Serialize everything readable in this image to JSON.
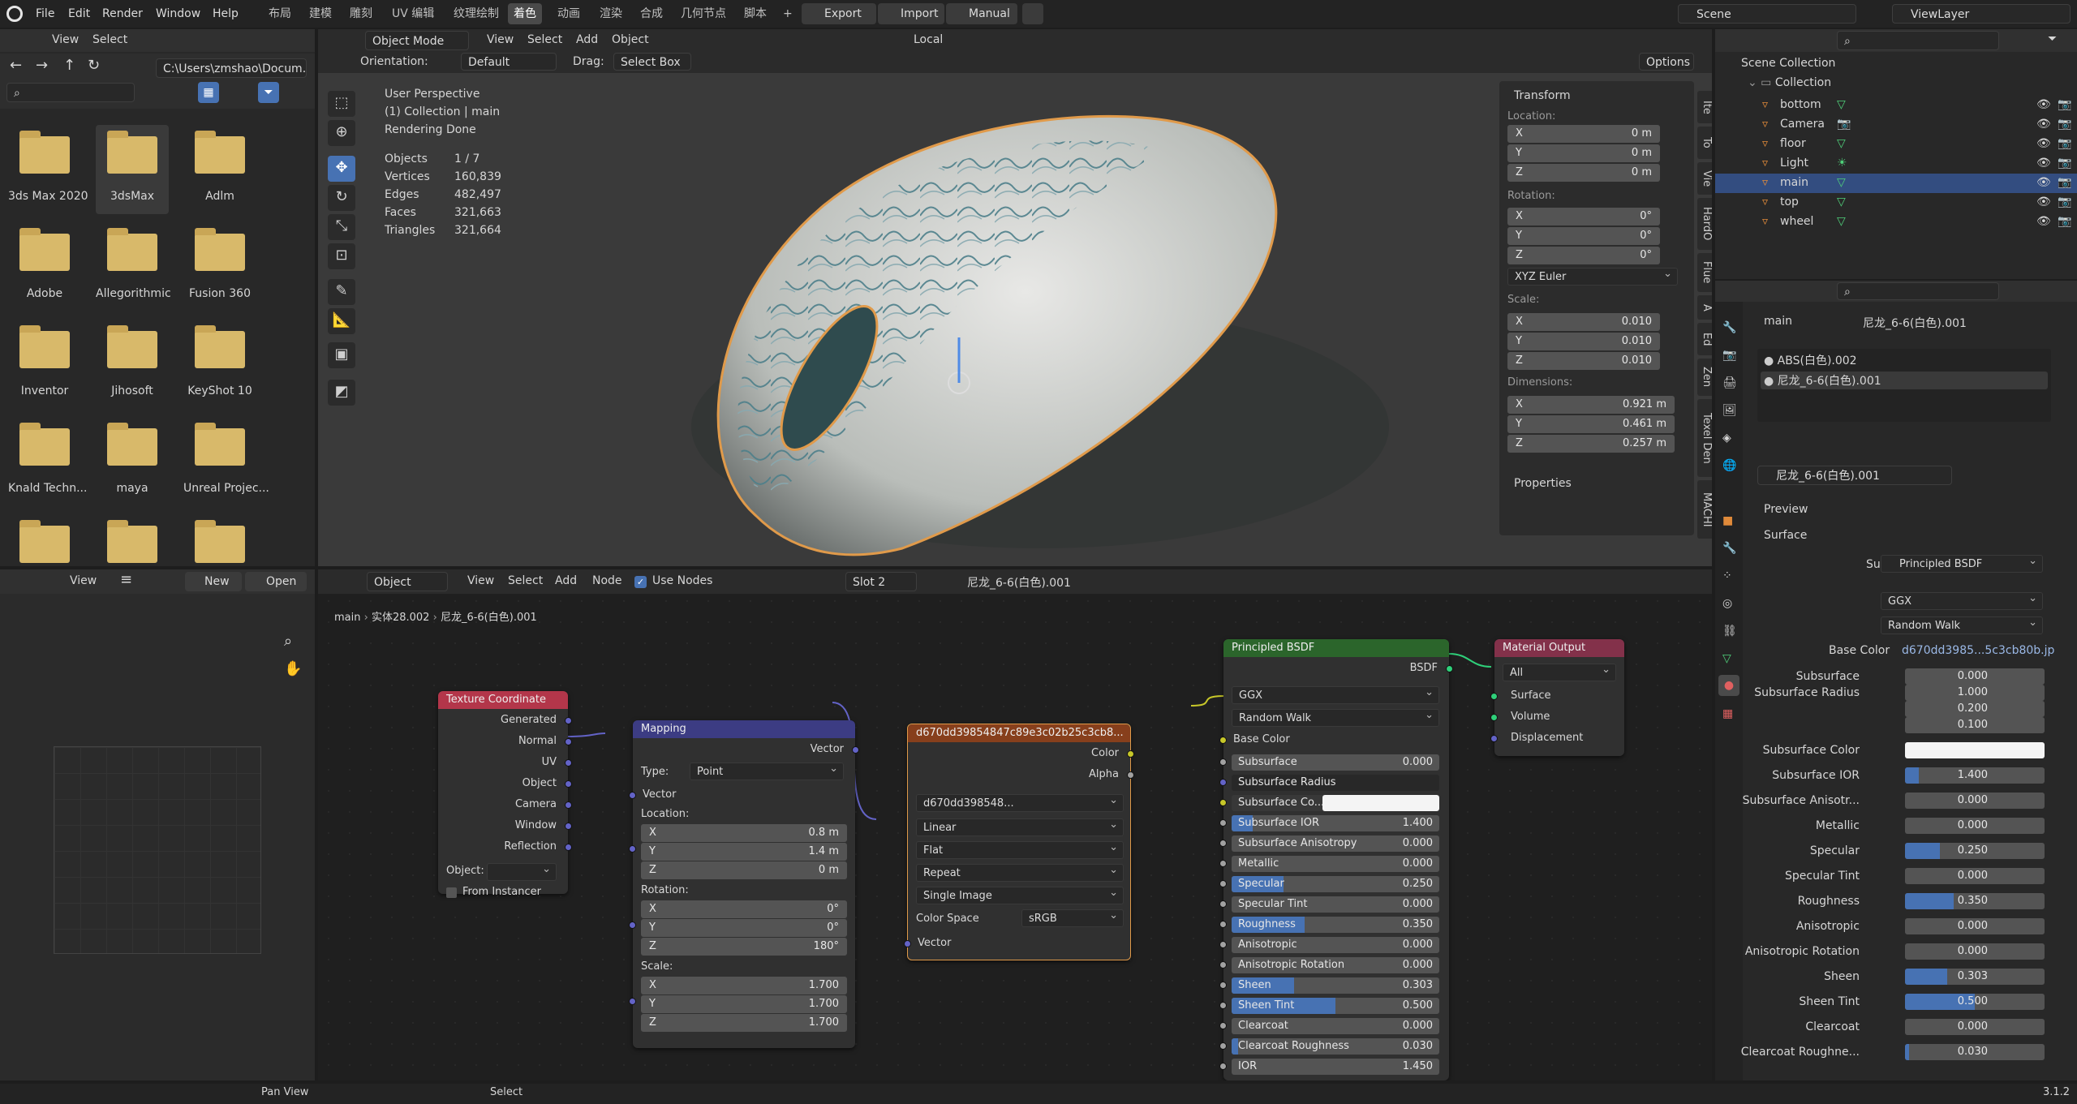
{
  "colors": {
    "accent": "#4772b3",
    "node_texcoord": "#b3364a",
    "node_mapping": "#3c3c83",
    "node_image": "#873f1c",
    "node_shader": "#2b652b",
    "node_output": "#83314a",
    "folder": "#d8b96a",
    "link_color": "#c7c729",
    "link_vector": "#6363c7"
  },
  "topbar": {
    "menus": [
      "File",
      "Edit",
      "Render",
      "Window",
      "Help"
    ],
    "workspaces": [
      "布局",
      "建模",
      "雕刻",
      "UV 编辑",
      "纹理绘制",
      "着色",
      "动画",
      "渲染",
      "合成",
      "几何节点",
      "脚本"
    ],
    "active_workspace": "着色",
    "export_label": "Export",
    "import_label": "Import",
    "manual_label": "Manual",
    "scene": "Scene",
    "view_layer": "ViewLayer"
  },
  "file_browser": {
    "view_label": "View",
    "select_label": "Select",
    "path": "C:\\Users\\zmshao\\Docum...",
    "folders": [
      "3ds Max 2020",
      "3dsMax",
      "Adlm",
      "Adobe",
      "Allegorithmic",
      "Fusion 360",
      "Inventor",
      "Jihosoft",
      "KeyShot 10",
      "Knald Techn...",
      "maya",
      "Unreal Projec..."
    ],
    "selected_folder": "3dsMax"
  },
  "viewport": {
    "mode": "Object Mode",
    "view": "View",
    "select": "Select",
    "add": "Add",
    "object": "Object",
    "orientation_label": "Orientation:",
    "orientation": "Default",
    "drag_label": "Drag:",
    "drag": "Select Box",
    "transform_space": "Local",
    "options": "Options",
    "overlay_title": "User Perspective",
    "overlay_collection": "(1) Collection | main",
    "overlay_status": "Rendering Done",
    "stats": [
      [
        "Objects",
        "1 / 7"
      ],
      [
        "Vertices",
        "160,839"
      ],
      [
        "Edges",
        "482,497"
      ],
      [
        "Faces",
        "321,663"
      ],
      [
        "Triangles",
        "321,664"
      ]
    ],
    "side_tabs": [
      "Ite",
      "To",
      "Vie",
      "HardO",
      "Flue",
      "A",
      "Ed",
      "Zen",
      "Texel Den",
      "MACHI"
    ]
  },
  "transform": {
    "title": "Transform",
    "location_label": "Location:",
    "location": [
      [
        "X",
        "0 m"
      ],
      [
        "Y",
        "0 m"
      ],
      [
        "Z",
        "0 m"
      ]
    ],
    "rotation_label": "Rotation:",
    "rotation": [
      [
        "X",
        "0°"
      ],
      [
        "Y",
        "0°"
      ],
      [
        "Z",
        "0°"
      ]
    ],
    "rotation_mode": "XYZ Euler",
    "scale_label": "Scale:",
    "scale": [
      [
        "X",
        "0.010"
      ],
      [
        "Y",
        "0.010"
      ],
      [
        "Z",
        "0.010"
      ]
    ],
    "dimensions_label": "Dimensions:",
    "dimensions": [
      [
        "X",
        "0.921 m"
      ],
      [
        "Y",
        "0.461 m"
      ],
      [
        "Z",
        "0.257 m"
      ]
    ],
    "properties": "Properties"
  },
  "image_editor": {
    "view": "View",
    "new": "New",
    "open": "Open"
  },
  "node_editor": {
    "object_mode": "Object",
    "view": "View",
    "select": "Select",
    "add": "Add",
    "node": "Node",
    "use_nodes": "Use Nodes",
    "slot": "Slot 2",
    "material": "尼龙_6-6(白色).001",
    "breadcrumb": [
      "main",
      "实体28.002",
      "尼龙_6-6(白色).001"
    ]
  },
  "nodes": {
    "texcoord": {
      "title": "Texture Coordinate",
      "outputs": [
        "Generated",
        "Normal",
        "UV",
        "Object",
        "Camera",
        "Window",
        "Reflection"
      ],
      "object_label": "Object:",
      "from_instancer": "From Instancer"
    },
    "mapping": {
      "title": "Mapping",
      "vector_out": "Vector",
      "type_label": "Type:",
      "type": "Point",
      "vector_in": "Vector",
      "location_label": "Location:",
      "location": [
        [
          "X",
          "0.8 m"
        ],
        [
          "Y",
          "1.4 m"
        ],
        [
          "Z",
          "0 m"
        ]
      ],
      "rotation_label": "Rotation:",
      "rotation": [
        [
          "X",
          "0°"
        ],
        [
          "Y",
          "0°"
        ],
        [
          "Z",
          "180°"
        ]
      ],
      "scale_label": "Scale:",
      "scale": [
        [
          "X",
          "1.700"
        ],
        [
          "Y",
          "1.700"
        ],
        [
          "Z",
          "1.700"
        ]
      ]
    },
    "image": {
      "title": "d670dd39854847c89e3c02b25c3cb8...",
      "color": "Color",
      "alpha": "Alpha",
      "image_name": "d670dd398548...",
      "interpolation": "Linear",
      "projection": "Flat",
      "extension": "Repeat",
      "source": "Single Image",
      "colorspace_label": "Color Space",
      "colorspace": "sRGB",
      "vector": "Vector"
    },
    "bsdf": {
      "title": "Principled BSDF",
      "out": "BSDF",
      "distribution": "GGX",
      "subsurface_method": "Random Walk",
      "base_color": "Base Color",
      "rows": [
        [
          "Subsurface",
          "0.000",
          0
        ],
        [
          "Subsurface Radius",
          "",
          -1
        ],
        [
          "Subsurface Co...",
          "",
          -2
        ],
        [
          "Subsurface IOR",
          "1.400",
          0.1
        ],
        [
          "Subsurface Anisotropy",
          "0.000",
          0
        ],
        [
          "Metallic",
          "0.000",
          0
        ],
        [
          "Specular",
          "0.250",
          0.25
        ],
        [
          "Specular Tint",
          "0.000",
          0
        ],
        [
          "Roughness",
          "0.350",
          0.35
        ],
        [
          "Anisotropic",
          "0.000",
          0
        ],
        [
          "Anisotropic Rotation",
          "0.000",
          0
        ],
        [
          "Sheen",
          "0.303",
          0.3
        ],
        [
          "Sheen Tint",
          "0.500",
          0.5
        ],
        [
          "Clearcoat",
          "0.000",
          0
        ],
        [
          "Clearcoat Roughness",
          "0.030",
          0.03
        ],
        [
          "IOR",
          "1.450",
          0
        ]
      ]
    },
    "output": {
      "title": "Material Output",
      "target": "All",
      "surface": "Surface",
      "volume": "Volume",
      "displacement": "Displacement"
    }
  },
  "outliner": {
    "search_placeholder": "",
    "scene_collection": "Scene Collection",
    "collection": "Collection",
    "items": [
      "bottom",
      "Camera",
      "floor",
      "Light",
      "main",
      "top",
      "wheel"
    ],
    "selected": "main"
  },
  "properties": {
    "object": "main",
    "material_name": "尼龙_6-6(白色).001",
    "slots": [
      "ABS(白色).002",
      "尼龙_6-6(白色).001"
    ],
    "preview": "Preview",
    "surface_section": "Surface",
    "surface_label": "Surface",
    "surface_value": "Principled BSDF",
    "distribution": "GGX",
    "subsurface_method": "Random Walk",
    "base_color_label": "Base Color",
    "base_color_value": "d670dd3985...5c3cb80b.jp",
    "rows": [
      [
        "Subsurface",
        "0.000",
        0
      ],
      [
        "Subsurface Radius",
        "1.000",
        0
      ],
      [
        "",
        "0.200",
        0
      ],
      [
        "",
        "0.100",
        0
      ],
      [
        "Subsurface Color",
        "",
        -2
      ],
      [
        "Subsurface IOR",
        "1.400",
        0.1
      ],
      [
        "Subsurface Anisotr...",
        "0.000",
        0
      ],
      [
        "Metallic",
        "0.000",
        0
      ],
      [
        "Specular",
        "0.250",
        0.25
      ],
      [
        "Specular Tint",
        "0.000",
        0
      ],
      [
        "Roughness",
        "0.350",
        0.35
      ],
      [
        "Anisotropic",
        "0.000",
        0
      ],
      [
        "Anisotropic Rotation",
        "0.000",
        0
      ],
      [
        "Sheen",
        "0.303",
        0.3
      ],
      [
        "Sheen Tint",
        "0.500",
        0.5
      ],
      [
        "Clearcoat",
        "0.000",
        0
      ],
      [
        "Clearcoat Roughne...",
        "0.030",
        0.03
      ]
    ]
  },
  "statusbar": {
    "pan": "Pan View",
    "select": "Select",
    "version": "3.1.2"
  }
}
